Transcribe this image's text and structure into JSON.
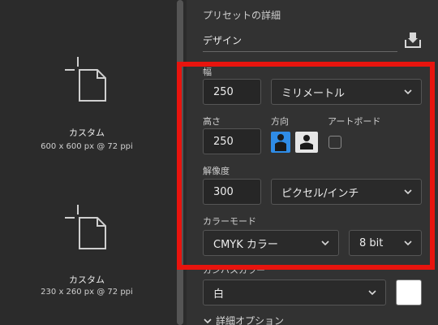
{
  "presets": [
    {
      "name": "カスタム",
      "size": "600 x 600 px @ 72 ppi"
    },
    {
      "name": "カスタム",
      "size": "230 x 260 px @ 72 ppi"
    }
  ],
  "details": {
    "section_title": "プリセットの詳細",
    "preset_name_value": "デザイン",
    "width_label": "幅",
    "width_value": "250",
    "width_unit": "ミリメートル",
    "height_label": "高さ",
    "height_value": "250",
    "orientation_label": "方向",
    "artboard_label": "アートボード",
    "resolution_label": "解像度",
    "resolution_value": "300",
    "resolution_unit": "ピクセル/インチ",
    "color_mode_label": "カラーモード",
    "color_mode_value": "CMYK カラー",
    "bit_depth_value": "8 bit",
    "background_label": "カンバスカラー",
    "background_value": "白",
    "advanced_label": "詳細オプション"
  },
  "colors": {
    "highlight": "#e8140e",
    "orientation_active": "#2f8ce6",
    "background_swatch": "#ffffff"
  },
  "icons": [
    "new-document-icon",
    "save-preset-icon",
    "chevron-down-icon",
    "portrait-icon",
    "landscape-icon"
  ]
}
